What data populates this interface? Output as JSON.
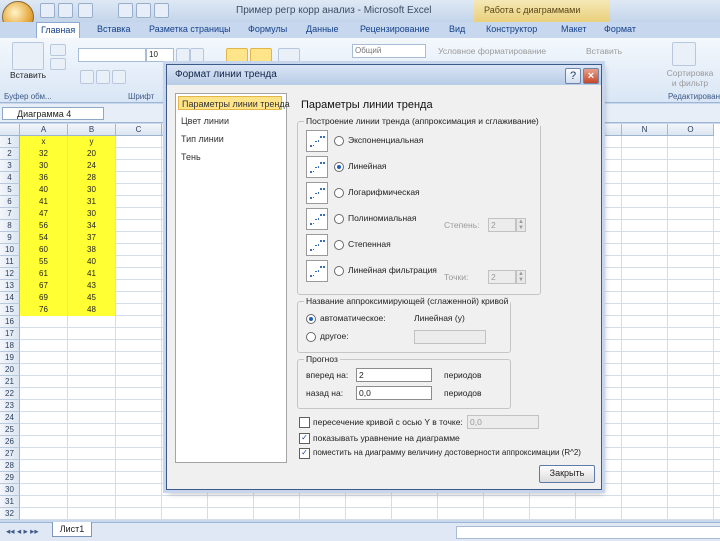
{
  "window": {
    "title": "Пример регр корр анализ - Microsoft Excel",
    "context_tab": "Работа с диаграммами"
  },
  "ribbon": {
    "tabs": [
      "Главная",
      "Вставка",
      "Разметка страницы",
      "Формулы",
      "Данные",
      "Рецензирование",
      "Вид",
      "Конструктор",
      "Макет",
      "Формат"
    ],
    "paste_label": "Вставить",
    "clipboard_group": "Буфер обм...",
    "font_group": "Шрифт",
    "font_size": "10",
    "number_format": "Общий",
    "conditional_format": "Условное форматирование",
    "insert_label": "Вставить",
    "sort_label": "Сортировка и фильтр",
    "editing_group": "Редактирование"
  },
  "formula_bar": {
    "name_box": "Диаграмма 4"
  },
  "sheet": {
    "columns": [
      "A",
      "B",
      "C",
      "D",
      "E",
      "F",
      "G",
      "H",
      "I",
      "J",
      "K",
      "L",
      "M",
      "N",
      "O"
    ],
    "header": [
      "x",
      "y"
    ],
    "rows": [
      [
        "32",
        "20"
      ],
      [
        "30",
        "24"
      ],
      [
        "36",
        "28"
      ],
      [
        "40",
        "30"
      ],
      [
        "41",
        "31"
      ],
      [
        "47",
        "30"
      ],
      [
        "56",
        "34"
      ],
      [
        "54",
        "37"
      ],
      [
        "60",
        "38"
      ],
      [
        "55",
        "40"
      ],
      [
        "61",
        "41"
      ],
      [
        "67",
        "43"
      ],
      [
        "69",
        "45"
      ],
      [
        "76",
        "48"
      ]
    ],
    "row_count": 32,
    "tab_name": "Лист1"
  },
  "dialog": {
    "title": "Формат линии тренда",
    "nav": [
      "Параметры линии тренда",
      "Цвет линии",
      "Тип линии",
      "Тень"
    ],
    "heading": "Параметры линии тренда",
    "group_build": "Построение линии тренда (аппроксимация и сглаживание)",
    "types": [
      "Экспоненциальная",
      "Линейная",
      "Логарифмическая",
      "Полиномиальная",
      "Степенная",
      "Линейная фильтрация"
    ],
    "selected_type": "Линейная",
    "degree_label": "Степень:",
    "degree_value": "2",
    "points_label": "Точки:",
    "points_value": "2",
    "group_name": "Название аппроксимирующей (сглаженной) кривой",
    "auto_label": "автоматическое:",
    "auto_value": "Линейная (у)",
    "other_label": "другое:",
    "group_forecast": "Прогноз",
    "forward_label": "вперед на:",
    "forward_value": "2",
    "back_label": "назад на:",
    "back_value": "0,0",
    "periods_label": "периодов",
    "intercept_label": "пересечение кривой с осью Y в точке:",
    "intercept_value": "0,0",
    "show_equation": "показывать уравнение на диаграмме",
    "show_r2": "поместить на диаграмму величину достоверности аппроксимации (R^2)",
    "close_button": "Закрыть"
  },
  "colors": {
    "highlight": "#ffff33",
    "nav_selected": "#ffe48a",
    "accent": "#15428b"
  }
}
